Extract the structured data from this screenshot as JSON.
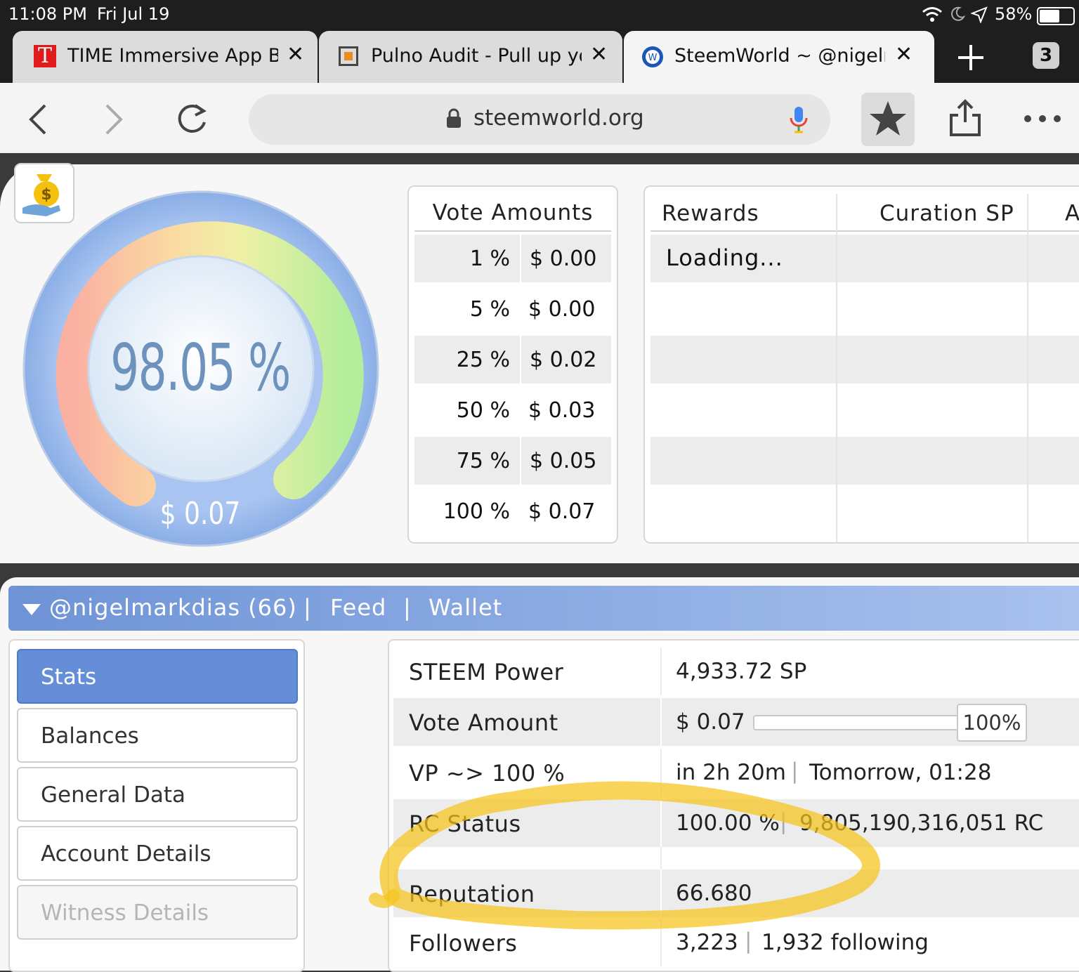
{
  "status_bar": {
    "time": "11:08 PM",
    "date": "Fri Jul 19",
    "battery": "58%"
  },
  "tabs": [
    {
      "title": "TIME Immersive App Bri",
      "icon": "time-logo-icon"
    },
    {
      "title": "Pulno Audit - Pull up you",
      "icon": "pulno-icon"
    },
    {
      "title": "SteemWorld ~ @nigelm",
      "icon": "steem-icon"
    }
  ],
  "tab_count": "3",
  "address": {
    "url": "steemworld.org"
  },
  "gauge": {
    "percent_label": "98.05 %",
    "value_label": "$ 0.07",
    "percent": 98.05
  },
  "vote_amounts": {
    "header": "Vote Amounts",
    "rows": [
      {
        "pct": "1 %",
        "usd": "$ 0.00"
      },
      {
        "pct": "5 %",
        "usd": "$ 0.00"
      },
      {
        "pct": "25 %",
        "usd": "$ 0.02"
      },
      {
        "pct": "50 %",
        "usd": "$ 0.03"
      },
      {
        "pct": "75 %",
        "usd": "$ 0.05"
      },
      {
        "pct": "100 %",
        "usd": "$ 0.07"
      }
    ]
  },
  "rewards": {
    "col1": "Rewards",
    "col2": "Curation SP",
    "col3": "A",
    "loading": "Loading..."
  },
  "account_bar": {
    "account": "@nigelmarkdias (66)",
    "sep": "|",
    "feed": "Feed",
    "wallet": "Wallet"
  },
  "side_nav": [
    "Stats",
    "Balances",
    "General Data",
    "Account Details",
    "Witness Details"
  ],
  "stats": {
    "steem_power": {
      "label": "STEEM Power",
      "value": "4,933.72 SP"
    },
    "vote_amount": {
      "label": "Vote Amount",
      "value": "$ 0.07",
      "slider_value": "100%",
      "slider_fraction": 1.0
    },
    "vp": {
      "label": "VP ~> 100 %",
      "value_a": "in 2h 20m",
      "value_b": "Tomorrow, 01:28"
    },
    "rc": {
      "label": "RC Status",
      "value_a": "100.00 %",
      "value_b": "9,805,190,316,051 RC"
    },
    "reputation": {
      "label": "Reputation",
      "value": "66.680"
    },
    "followers": {
      "label": "Followers",
      "value_a": "3,223",
      "value_b": "1,932 following"
    }
  },
  "colors": {
    "accent_blue": "#668ed8",
    "highlight": "#f5c51a"
  }
}
